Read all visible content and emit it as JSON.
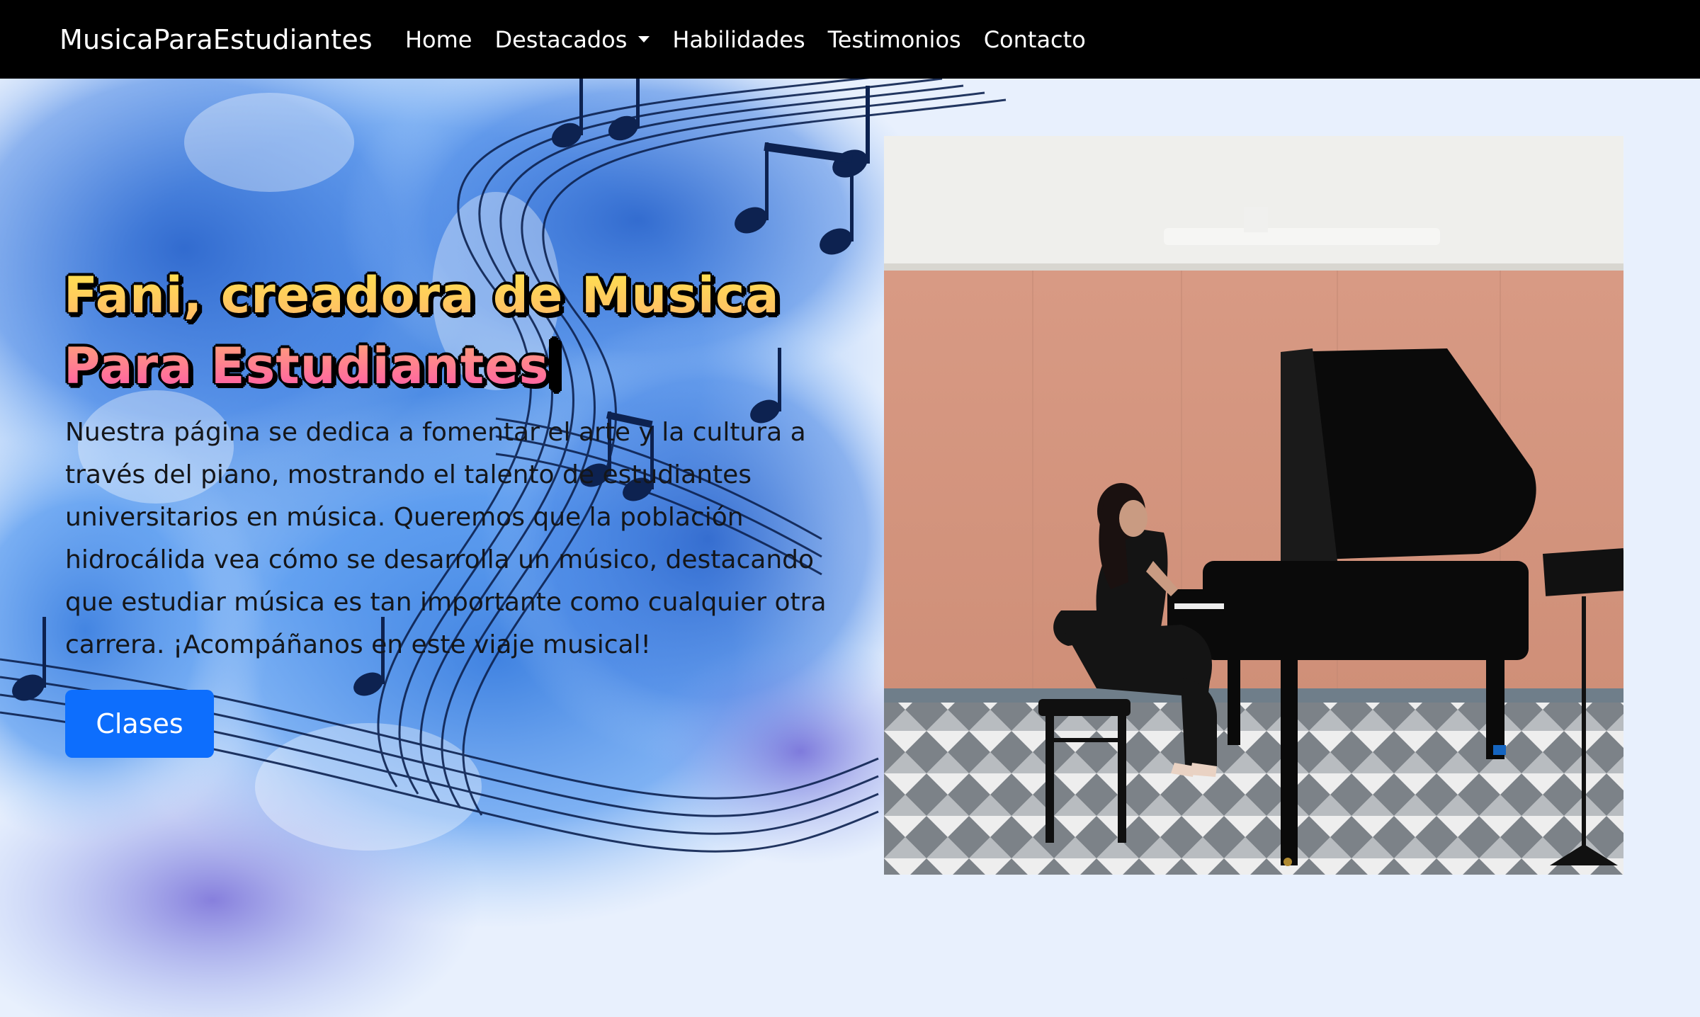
{
  "navbar": {
    "brand": "MusicaParaEstudiantes",
    "links": [
      {
        "label": "Home"
      },
      {
        "label": "Destacados",
        "dropdown": true
      },
      {
        "label": "Habilidades"
      },
      {
        "label": "Testimonios"
      },
      {
        "label": "Contacto"
      }
    ]
  },
  "hero": {
    "headline_line1": "Fani, creadora de Musica",
    "headline_line2": "Para Estudiantes",
    "description": "Nuestra página se dedica a fomentar el arte y la cultura a través del piano, mostrando el talento de estudiantes universitarios en música. Queremos que la población hidrocálida vea cómo se desarrolla un músico, destacando que estudiar música es tan importante como cualquier otra carrera. ¡Acompáñanos en este viaje musical!",
    "cta_label": "Clases"
  },
  "colors": {
    "navbar_bg": "#000000",
    "primary_button": "#0d6efd",
    "page_bg": "#e8f0fd"
  },
  "icons": [
    "chevron-down-icon",
    "music-notes-background",
    "piano-photo"
  ]
}
